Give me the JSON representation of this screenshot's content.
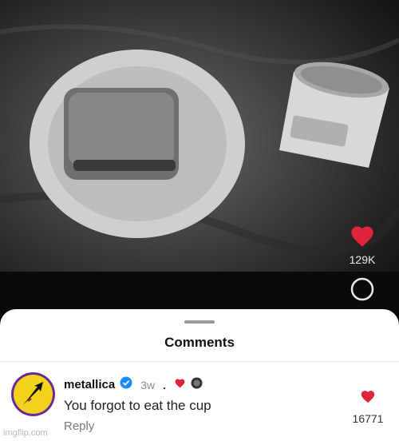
{
  "video": {
    "like_count": "129K",
    "icons": [
      "heart-icon",
      "comment-icon"
    ]
  },
  "comments_sheet": {
    "title": "Comments",
    "comment": {
      "username": "metallica",
      "verified": true,
      "time": "3w",
      "separator": ".",
      "text": "You forgot to eat the cup",
      "reply_label": "Reply",
      "like_count": "16771"
    }
  },
  "colors": {
    "heart": "#e0243c",
    "verified": "#1a8cff",
    "avatar_ring": "#6b2a9a",
    "avatar_fill": "#f2d21a"
  },
  "watermark": "imgflip.com"
}
